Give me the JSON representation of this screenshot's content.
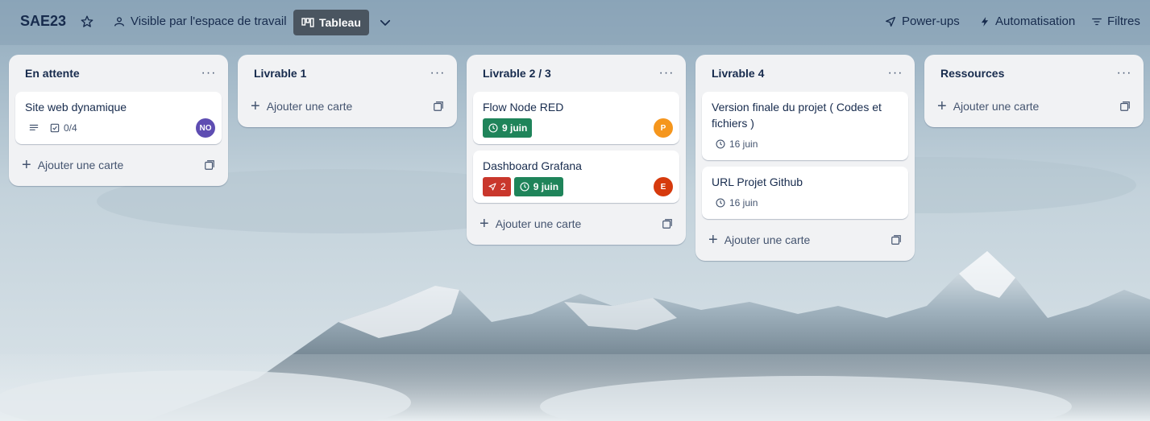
{
  "board": {
    "title": "SAE23",
    "visibility": "Visible par l'espace de travail",
    "view": "Tableau",
    "powerups": "Power-ups",
    "automation": "Automatisation",
    "filters": "Filtres"
  },
  "add_card_label": "Ajouter une carte",
  "lists": [
    {
      "title": "En attente",
      "cards": [
        {
          "title": "Site web dynamique",
          "checklist": "0/4",
          "avatar": "NO",
          "avatar_color": "#5e4db2"
        }
      ]
    },
    {
      "title": "Livrable 1",
      "cards": []
    },
    {
      "title": "Livrable 2 / 3",
      "cards": [
        {
          "title": "Flow Node RED",
          "due": "9 juin",
          "avatar": "P",
          "avatar_color": "#f5961d"
        },
        {
          "title": "Dashboard Grafana",
          "attachments": "2",
          "due": "9 juin",
          "avatar": "E",
          "avatar_color": "#d63a0d"
        }
      ]
    },
    {
      "title": "Livrable 4",
      "cards": [
        {
          "title": "Version finale du projet ( Codes et fichiers )",
          "due": "16 juin"
        },
        {
          "title": "URL Projet Github",
          "due": "16 juin"
        }
      ]
    },
    {
      "title": "Ressources",
      "cards": []
    }
  ],
  "colors": {
    "due_green": "#1f845a",
    "attachment_red": "#c9372c",
    "view_button": "#4a5560",
    "list_bg": "#f1f2f4"
  },
  "icons": [
    "star-icon",
    "visibility-icon",
    "board-view-icon",
    "chevron-down-icon",
    "rocket-icon",
    "lightning-icon",
    "filter-icon",
    "more-icon",
    "description-icon",
    "checklist-icon",
    "clock-icon",
    "plus-icon",
    "template-icon"
  ]
}
